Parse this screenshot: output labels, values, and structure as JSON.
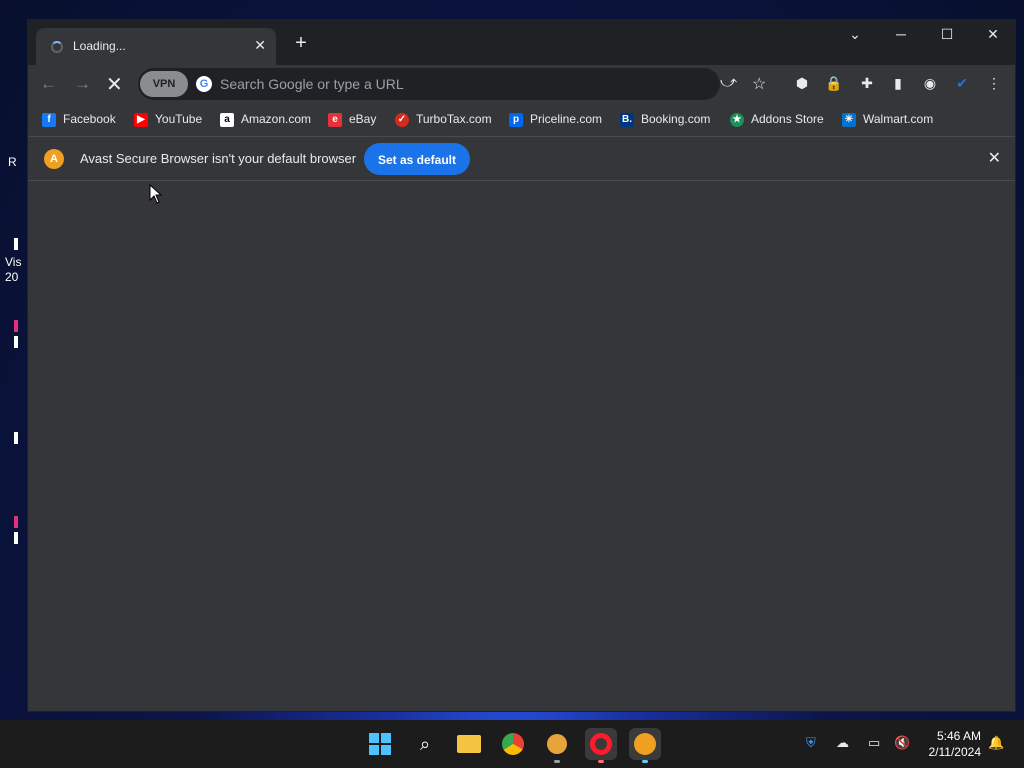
{
  "desktop": {
    "label_1": "R",
    "label_2a": "Vis",
    "label_2b": "20"
  },
  "tab": {
    "title": "Loading...",
    "close": "✕"
  },
  "newtab": "+",
  "window": {
    "min": "─",
    "max": "☐",
    "close": "✕",
    "tabsearch": "⌄"
  },
  "toolbar": {
    "back": "←",
    "forward": "→",
    "reload": "✕",
    "vpn": "VPN",
    "search_placeholder": "Search Google or type a URL"
  },
  "bookmarks": [
    {
      "label": "Facebook",
      "icon": "f",
      "color": "#1877f2"
    },
    {
      "label": "YouTube",
      "icon": "▶",
      "color": "#ff0000"
    },
    {
      "label": "Amazon.com",
      "icon": "a",
      "color": "#ffffff"
    },
    {
      "label": "eBay",
      "icon": "e",
      "color": "#e53238"
    },
    {
      "label": "TurboTax.com",
      "icon": "✓",
      "color": "#d52b1e"
    },
    {
      "label": "Priceline.com",
      "icon": "p",
      "color": "#0068ef"
    },
    {
      "label": "Booking.com",
      "icon": "B.",
      "color": "#003580"
    },
    {
      "label": "Addons Store",
      "icon": "★",
      "color": "#1a8f5a"
    },
    {
      "label": "Walmart.com",
      "icon": "✳",
      "color": "#0071ce"
    }
  ],
  "infobar": {
    "message": "Avast Secure Browser isn't your default browser",
    "button": "Set as default",
    "close": "✕"
  },
  "taskbar": {
    "time": "5:46 AM",
    "date": "2/11/2024"
  }
}
